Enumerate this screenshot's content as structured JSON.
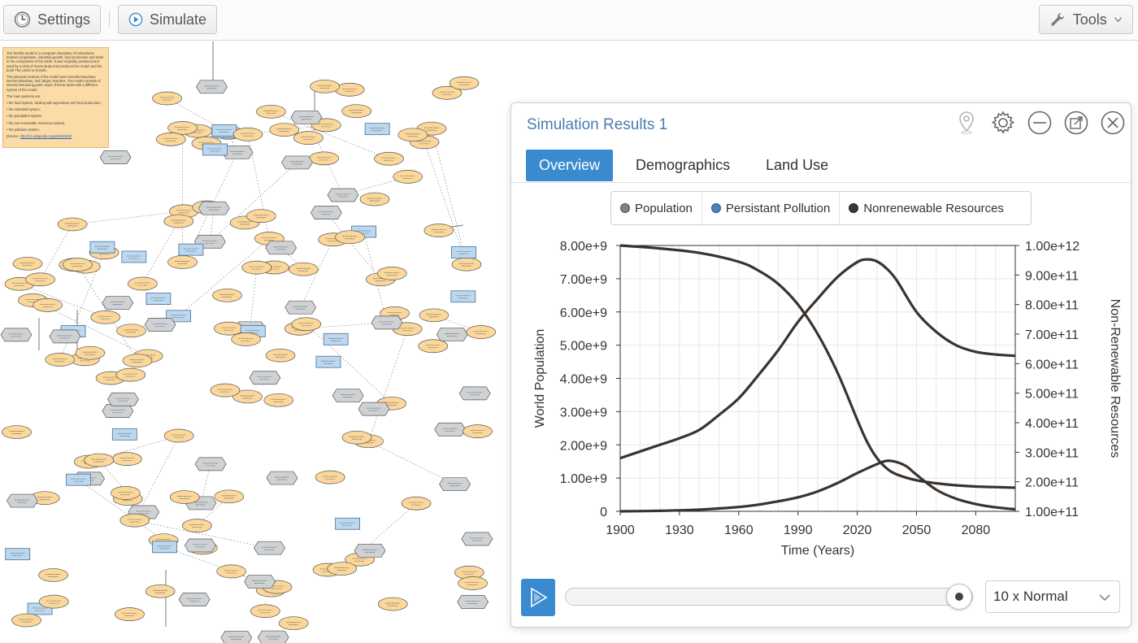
{
  "toolbar": {
    "settings_label": "Settings",
    "simulate_label": "Simulate",
    "tools_label": "Tools"
  },
  "model": {
    "description": [
      "The World3 model is a computer simulation of interactions between population, industrial growth, food production and limits in the ecosystems of the Earth. It was originally produced and used by a Club of Rome study that produced the model and the book The Limits to Growth.",
      "The principal creators of the model were Donella Meadows, Dennis Meadows, and Jørgen Randers. The model consists of several interacting parts. Each of these deals with a different system of the model.",
      "The main systems are:",
      "• the food system, dealing with agriculture and food production,",
      "• the industrial system,",
      "• the population system,",
      "• the non-renewable resources system,",
      "• the pollution system."
    ],
    "source_prefix": "[Source:",
    "source_link": "http://en.wikipedia.org/wiki/World3"
  },
  "results": {
    "title": "Simulation Results 1",
    "tabs": [
      "Overview",
      "Demographics",
      "Land Use"
    ],
    "active_tab": 0,
    "icons": [
      "location-pin-icon",
      "gear-icon",
      "minimize-icon",
      "pop-out-icon",
      "close-icon"
    ],
    "legend": [
      {
        "label": "Population",
        "color": "#8a7f70"
      },
      {
        "label": "Persistant Pollution",
        "color": "#4a82c4"
      },
      {
        "label": "Nonrenewable Resources",
        "color": "#3c3631"
      }
    ],
    "speed": "10 x Normal",
    "progress": 1.0
  },
  "chart_data": {
    "type": "line",
    "xlabel": "Time (Years)",
    "ylabel_left": "World Population",
    "ylabel_right": "Non-Renewable Resources",
    "xlim": [
      1900,
      2100
    ],
    "x_ticks": [
      "1900",
      "1930",
      "1960",
      "1990",
      "2020",
      "2050",
      "2080"
    ],
    "x_tick_values": [
      1900,
      1930,
      1960,
      1990,
      2020,
      2050,
      2080
    ],
    "y_left_ticks": [
      "0",
      "1.00e+9",
      "2.00e+9",
      "3.00e+9",
      "4.00e+9",
      "5.00e+9",
      "6.00e+9",
      "7.00e+9",
      "8.00e+9"
    ],
    "y_left_lim": [
      0,
      8000000000
    ],
    "y_right_ticks": [
      "1.00e+11",
      "2.00e+11",
      "3.00e+11",
      "4.00e+11",
      "5.00e+11",
      "6.00e+11",
      "7.00e+11",
      "8.00e+11",
      "9.00e+11",
      "1.00e+12"
    ],
    "y_right_lim": [
      100000000000,
      1000000000000
    ],
    "grid": true,
    "series": [
      {
        "name": "Population",
        "axis": "left",
        "x": [
          1900,
          1910,
          1920,
          1930,
          1940,
          1950,
          1960,
          1970,
          1980,
          1990,
          2000,
          2010,
          2020,
          2025,
          2030,
          2035,
          2040,
          2050,
          2060,
          2070,
          2080,
          2090,
          2100
        ],
        "values": [
          1600000000,
          1800000000,
          2000000000,
          2200000000,
          2450000000,
          2900000000,
          3400000000,
          4100000000,
          4850000000,
          5700000000,
          6400000000,
          7050000000,
          7500000000,
          7580000000,
          7520000000,
          7300000000,
          6950000000,
          6000000000,
          5400000000,
          5000000000,
          4800000000,
          4720000000,
          4680000000
        ]
      },
      {
        "name": "Persistant Pollution",
        "axis": "left",
        "x": [
          1900,
          1920,
          1940,
          1960,
          1970,
          1980,
          1990,
          2000,
          2010,
          2020,
          2030,
          2035,
          2040,
          2045,
          2050,
          2060,
          2070,
          2080,
          2090,
          2100
        ],
        "values": [
          0,
          15000000,
          50000000,
          130000000,
          200000000,
          300000000,
          420000000,
          600000000,
          850000000,
          1150000000,
          1420000000,
          1520000000,
          1480000000,
          1350000000,
          1100000000,
          650000000,
          380000000,
          220000000,
          120000000,
          60000000
        ]
      },
      {
        "name": "Nonrenewable Resources",
        "axis": "right",
        "x": [
          1900,
          1920,
          1940,
          1960,
          1970,
          1980,
          1990,
          2000,
          2010,
          2020,
          2025,
          2030,
          2035,
          2040,
          2050,
          2060,
          2070,
          2080,
          2090,
          2100
        ],
        "values": [
          1000000000000,
          990000000000,
          975000000000,
          945000000000,
          915000000000,
          870000000000,
          800000000000,
          700000000000,
          570000000000,
          410000000000,
          335000000000,
          280000000000,
          245000000000,
          225000000000,
          205000000000,
          195000000000,
          188000000000,
          184000000000,
          182000000000,
          180000000000
        ]
      }
    ]
  }
}
